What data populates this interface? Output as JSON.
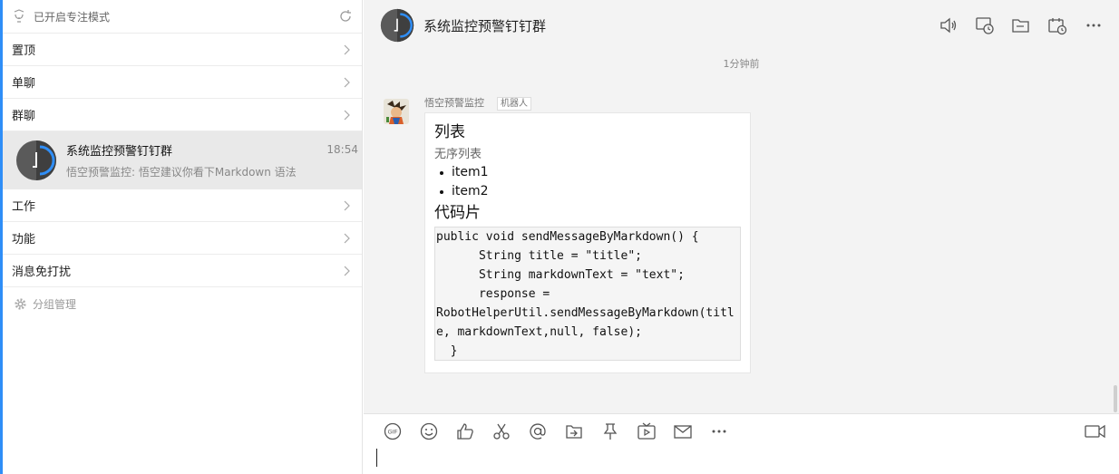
{
  "sidebar": {
    "focus_mode": "已开启专注模式",
    "groups": [
      {
        "label": "置顶"
      },
      {
        "label": "单聊"
      },
      {
        "label": "群聊"
      }
    ],
    "active_conversation": {
      "name": "系统监控预警钉钉群",
      "preview": "悟空预警监控: 悟空建议你看下Markdown 语法",
      "time": "18:54"
    },
    "groups_after": [
      {
        "label": "工作"
      },
      {
        "label": "功能"
      },
      {
        "label": "消息免打扰"
      }
    ],
    "manage": "分组管理"
  },
  "header": {
    "title": "系统监控预警钉钉群",
    "icons": [
      "speaker-icon",
      "chat-history-icon",
      "folder-icon",
      "calendar-icon",
      "more-icon"
    ]
  },
  "chat": {
    "timestamp": "1分钟前",
    "message": {
      "sender": "悟空预警监控",
      "badge": "机器人",
      "heading1": "列表",
      "subheading": "无序列表",
      "items": [
        "item1",
        "item2"
      ],
      "heading2": "代码片",
      "code": "public void sendMessageByMarkdown() {\n      String title = \"title\";\n      String markdownText = \"text\";\n      response =\nRobotHelperUtil.sendMessageByMarkdown(titl\ne, markdownText,null, false);\n  }"
    }
  },
  "composer": {
    "tools": [
      "gif-icon",
      "emoji-icon",
      "like-icon",
      "scissors-icon",
      "mention-icon",
      "share-icon",
      "pin-icon",
      "live-icon",
      "mail-icon",
      "more-icon"
    ],
    "video": "video-call-icon"
  },
  "colors": {
    "accent": "#2f8ef7",
    "active_bg": "#e9e9e9",
    "main_bg": "#f3f3f3"
  }
}
